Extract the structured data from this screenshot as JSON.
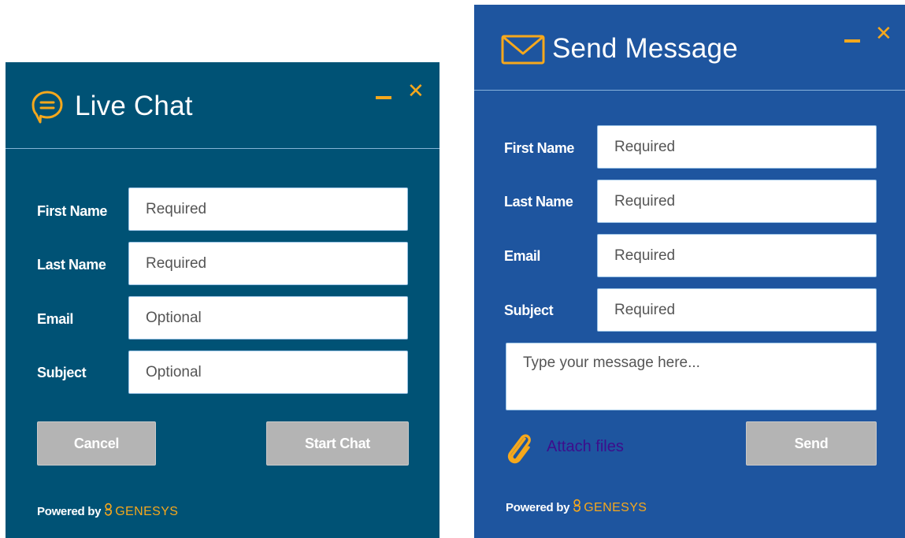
{
  "live_chat": {
    "title": "Live Chat",
    "title_icon": "chat-bubble-icon",
    "minimize_icon": "minimize-icon",
    "close_label": "✕",
    "fields": [
      {
        "label": "First Name",
        "placeholder": "Required"
      },
      {
        "label": "Last Name",
        "placeholder": "Required"
      },
      {
        "label": "Email",
        "placeholder": "Optional"
      },
      {
        "label": "Subject",
        "placeholder": "Optional"
      }
    ],
    "cancel_label": "Cancel",
    "start_label": "Start Chat",
    "powered_by": "Powered by",
    "brand": "GENESYS"
  },
  "send_message": {
    "title": "Send Message",
    "title_icon": "envelope-icon",
    "minimize_icon": "minimize-icon",
    "close_label": "✕",
    "fields": [
      {
        "label": "First Name",
        "placeholder": "Required"
      },
      {
        "label": "Last Name",
        "placeholder": "Required"
      },
      {
        "label": "Email",
        "placeholder": "Required"
      },
      {
        "label": "Subject",
        "placeholder": "Required"
      }
    ],
    "message_placeholder": "Type your message here...",
    "attach_icon": "paperclip-icon",
    "attach_label": "Attach files",
    "send_label": "Send",
    "powered_by": "Powered by",
    "brand": "GENESYS"
  },
  "colors": {
    "live_chat_bg": "#005275",
    "send_message_bg": "#1e559f",
    "accent": "#f6a81c",
    "button_disabled": "#b4b4b4",
    "link": "#3d0e8c",
    "divider": "#9cc4e6"
  }
}
